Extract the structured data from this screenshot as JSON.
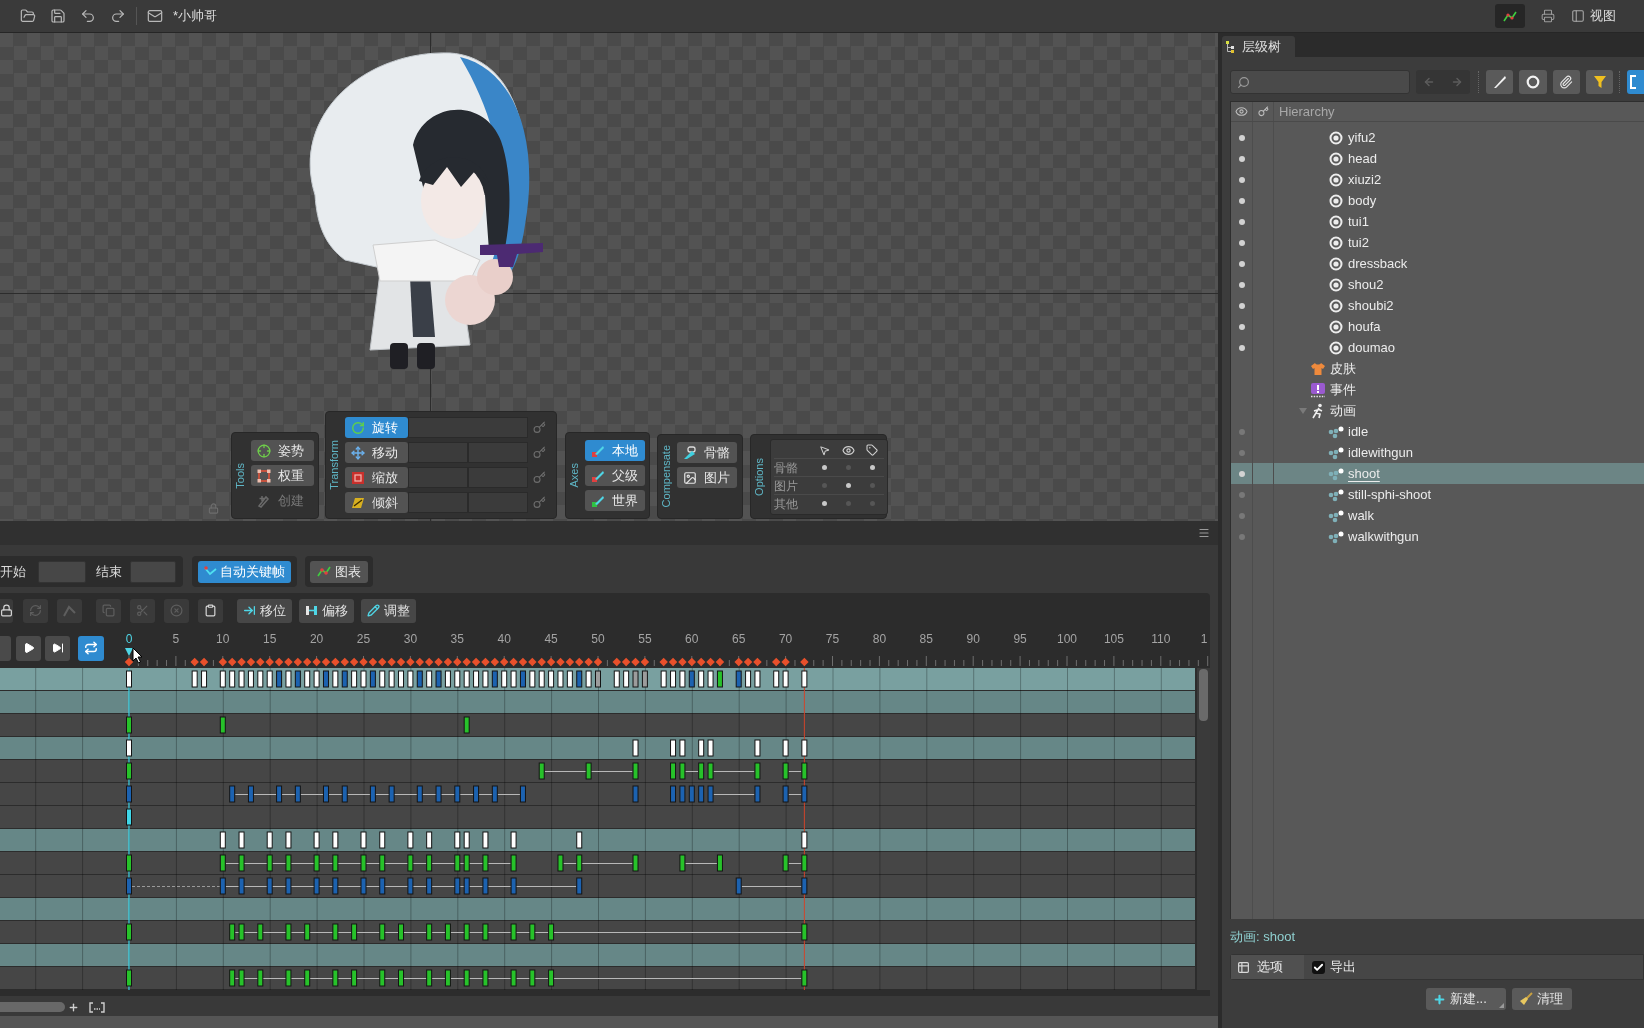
{
  "app": {
    "title": "*小帅哥",
    "view_menu": "视图"
  },
  "viewport": {
    "tools": {
      "label": "Tools",
      "items": [
        {
          "label": "姿势",
          "kind": "pose",
          "disabled": false
        },
        {
          "label": "权重",
          "kind": "weights",
          "disabled": false
        },
        {
          "label": "创建",
          "kind": "create",
          "disabled": true
        }
      ]
    },
    "transform": {
      "label": "Transform",
      "items": [
        {
          "label": "旋转",
          "kind": "rotate",
          "selected": true
        },
        {
          "label": "移动",
          "kind": "translate",
          "selected": false
        },
        {
          "label": "缩放",
          "kind": "scale",
          "selected": false
        },
        {
          "label": "倾斜",
          "kind": "shear",
          "selected": false
        }
      ]
    },
    "axes": {
      "label": "Axes",
      "items": [
        {
          "label": "本地",
          "kind": "local",
          "selected": true
        },
        {
          "label": "父级",
          "kind": "parent",
          "selected": false
        },
        {
          "label": "世界",
          "kind": "world",
          "selected": false
        }
      ]
    },
    "compensate": {
      "label": "Compensate",
      "items": [
        {
          "label": "骨骼",
          "kind": "bones",
          "on": false
        },
        {
          "label": "图片",
          "kind": "images",
          "on": false
        }
      ]
    },
    "options": {
      "label": "Options",
      "rows": [
        {
          "label": "骨骼",
          "select": true,
          "visible": false,
          "names": true
        },
        {
          "label": "图片",
          "select": false,
          "visible": true,
          "names": false
        },
        {
          "label": "其他",
          "select": true,
          "visible": false,
          "names": false
        }
      ]
    }
  },
  "timeline": {
    "start": {
      "label": "开始"
    },
    "end": {
      "label": "结束"
    },
    "auto_key": {
      "label": "自动关键帧",
      "on": true
    },
    "graph": {
      "label": "图表"
    },
    "key_tools": [
      {
        "kind": "lock",
        "disabled": false
      },
      {
        "kind": "loop",
        "disabled": true
      },
      {
        "kind": "bend",
        "disabled": true
      },
      {
        "kind": "copy",
        "disabled": true
      },
      {
        "kind": "cut",
        "disabled": true
      },
      {
        "kind": "delete",
        "disabled": true
      },
      {
        "kind": "paste",
        "disabled": false
      }
    ],
    "adjust_tools": [
      {
        "label": "移位",
        "kind": "shift"
      },
      {
        "label": "偏移",
        "kind": "offset"
      },
      {
        "label": "调整",
        "kind": "adjust"
      }
    ],
    "playback": {
      "loop": true
    },
    "ruler": [
      {
        "label": "0",
        "selected": true
      },
      {
        "label": "5",
        "selected": false
      },
      {
        "label": "10",
        "selected": false
      },
      {
        "label": "15",
        "selected": false
      },
      {
        "label": "20",
        "selected": false
      },
      {
        "label": "25",
        "selected": false
      },
      {
        "label": "30",
        "selected": false
      },
      {
        "label": "35",
        "selected": false
      },
      {
        "label": "40",
        "selected": false
      },
      {
        "label": "45",
        "selected": false
      },
      {
        "label": "50",
        "selected": false
      },
      {
        "label": "55",
        "selected": false
      },
      {
        "label": "60",
        "selected": false
      },
      {
        "label": "65",
        "selected": false
      },
      {
        "label": "70",
        "selected": false
      },
      {
        "label": "75",
        "selected": false
      },
      {
        "label": "80",
        "selected": false
      },
      {
        "label": "85",
        "selected": false
      },
      {
        "label": "90",
        "selected": false
      },
      {
        "label": "95",
        "selected": false
      },
      {
        "label": "100",
        "selected": false
      },
      {
        "label": "105",
        "selected": false
      },
      {
        "label": "110",
        "selected": false
      },
      {
        "label": "1",
        "selected": false
      }
    ],
    "tracks": [
      {
        "kind": "summary"
      },
      {
        "kind": "header"
      },
      {
        "kind": "timeline"
      },
      {
        "kind": "header"
      },
      {
        "kind": "timeline"
      },
      {
        "kind": "timeline"
      },
      {
        "kind": "timeline"
      },
      {
        "kind": "header"
      },
      {
        "kind": "timeline"
      },
      {
        "kind": "timeline"
      },
      {
        "kind": "header"
      },
      {
        "kind": "timeline"
      },
      {
        "kind": "header"
      },
      {
        "kind": "timeline"
      }
    ]
  },
  "hierarchy": {
    "tab": "层级树",
    "header": "Hierarchy",
    "items": [
      {
        "children": [
          {
            "label": "yifu2",
            "kind": "slot",
            "visible": true
          },
          {
            "label": "head",
            "kind": "slot",
            "visible": true
          },
          {
            "label": "xiuzi2",
            "kind": "slot",
            "visible": true
          },
          {
            "label": "body",
            "kind": "slot",
            "visible": true
          },
          {
            "label": "tui1",
            "kind": "slot",
            "visible": true
          },
          {
            "label": "tui2",
            "kind": "slot",
            "visible": true
          },
          {
            "label": "dressback",
            "kind": "slot",
            "visible": true
          },
          {
            "label": "shou2",
            "kind": "slot",
            "visible": true
          },
          {
            "label": "shoubi2",
            "kind": "slot",
            "visible": true
          },
          {
            "label": "houfa",
            "kind": "slot",
            "visible": true
          },
          {
            "label": "doumao",
            "kind": "slot",
            "visible": true
          }
        ]
      },
      {
        "label": "皮肤",
        "kind": "skins"
      },
      {
        "label": "事件",
        "kind": "events"
      },
      {
        "label": "动画",
        "kind": "animations",
        "expanded": true,
        "children": [
          {
            "label": "idle",
            "kind": "animation",
            "visible": false,
            "selected": false
          },
          {
            "label": "idlewithgun",
            "kind": "animation",
            "visible": false,
            "selected": false
          },
          {
            "label": "shoot",
            "kind": "animation",
            "visible": true,
            "selected": true
          },
          {
            "label": "still-sphi-shoot",
            "kind": "animation",
            "visible": false,
            "selected": false
          },
          {
            "label": "walk",
            "kind": "animation",
            "visible": false,
            "selected": false
          },
          {
            "label": "walkwithgun",
            "kind": "animation",
            "visible": false,
            "selected": false
          }
        ]
      }
    ],
    "status": "动画: shoot",
    "options_tab": "选项",
    "export": {
      "label": "导出",
      "checked": true
    },
    "buttons": [
      {
        "label": "新建...",
        "kind": "new"
      },
      {
        "label": "清理",
        "kind": "clean"
      }
    ]
  }
}
